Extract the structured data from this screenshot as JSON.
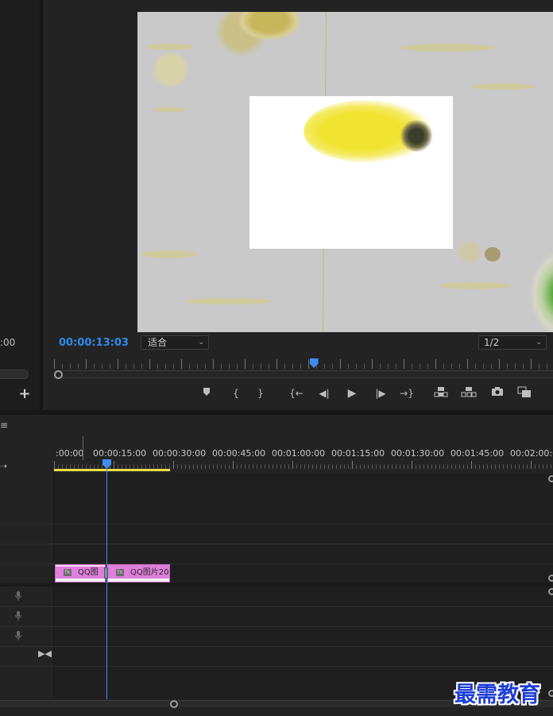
{
  "source_panel": {
    "timecode": ":00",
    "add_label": "+"
  },
  "program_monitor": {
    "timecode": "00:00:13:03",
    "fit_select": {
      "value": "适合"
    },
    "resolution_select": {
      "value": "1/2"
    },
    "playhead_fraction": 0.52,
    "transport": {
      "marker": "marker-icon",
      "mark_in": "{",
      "mark_out": "}",
      "go_to_in": "{←",
      "step_back": "◀|",
      "play": "▶",
      "step_forward": "|▶",
      "go_to_out": "→}",
      "lift": "lift-icon",
      "extract": "extract-icon",
      "export_frame": "camera-icon",
      "compare": "compare-icon"
    }
  },
  "timeline": {
    "menu_label": "≡",
    "ruler_labels": [
      ":00:00",
      "00:00:15:00",
      "00:00:30:00",
      "00:00:45:00",
      "00:01:00:00",
      "00:01:15:00",
      "00:01:30:00",
      "00:01:45:00",
      "00:02:00:0"
    ],
    "clips": [
      {
        "fx": "fx",
        "label": "QQ图"
      },
      {
        "fx": "fx",
        "label": "QQ图片20"
      }
    ],
    "colors": {
      "clip": "#e07fdc",
      "playhead": "#3b8ef0",
      "work_area": "#e9e04a",
      "timecode": "#2d8ceb"
    }
  },
  "watermark": "最需教育"
}
